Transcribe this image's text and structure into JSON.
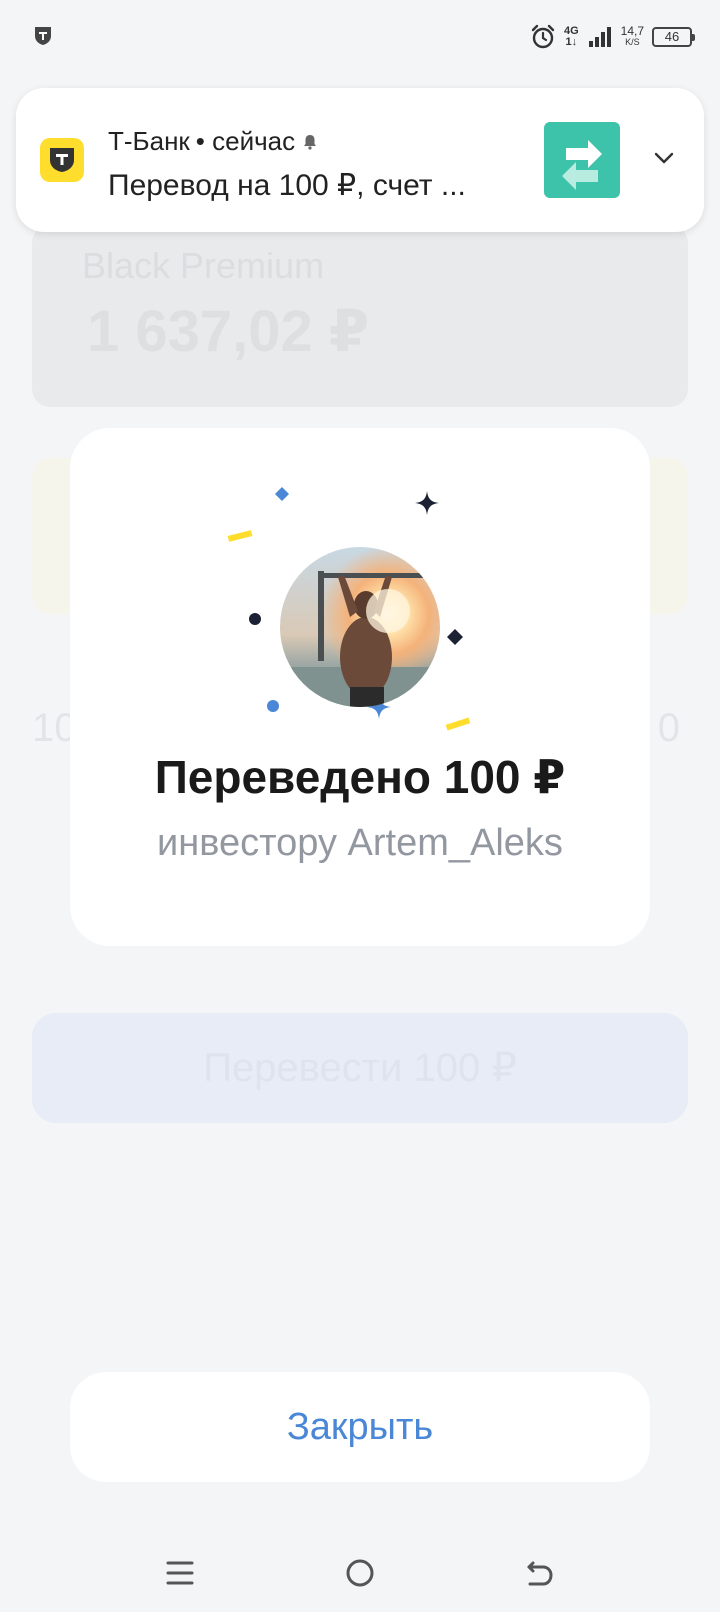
{
  "status_bar": {
    "network": "4G",
    "network_sub": "1↓",
    "speed_value": "14,7",
    "speed_unit": "K/S",
    "battery": "46"
  },
  "background": {
    "card_name": "Black Premium",
    "card_balance": "1 637,02 ₽",
    "amount_left": "10",
    "amount_right": "0",
    "transfer_button": "Перевести 100 ₽"
  },
  "notification": {
    "app_name": "Т-Банк",
    "time": "• сейчас",
    "text": "Перевод на 100 ₽, счет ...",
    "colors": {
      "app_icon": "#ffdd2d",
      "thumb": "#3cc3a9"
    }
  },
  "modal": {
    "title": "Переведено 100 ₽",
    "subtitle": "инвестору Artem_Aleks"
  },
  "close_button": {
    "label": "Закрыть",
    "color": "#4a87d6"
  },
  "nav": {
    "icons": [
      "menu-icon",
      "home-icon",
      "back-icon"
    ]
  }
}
